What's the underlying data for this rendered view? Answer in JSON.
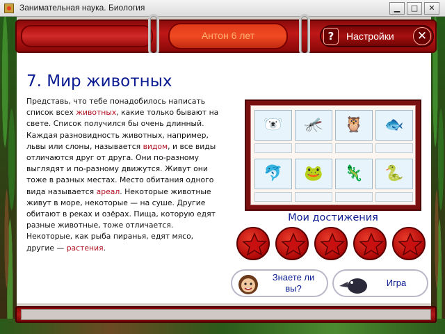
{
  "window": {
    "title": "Занимательная наука. Биология",
    "min_glyph": "▁",
    "max_glyph": "□",
    "close_glyph": "✕"
  },
  "header": {
    "user_label": "Антон 6 лет",
    "help_glyph": "?",
    "settings_label": "Настройки",
    "close_glyph": "✕"
  },
  "lesson": {
    "title": "7. Мир животных",
    "text_parts": [
      {
        "text": "Представь, что тебе понадобилось написать список всех ",
        "hl": false
      },
      {
        "text": "животных",
        "hl": true
      },
      {
        "text": ", какие только бывают на свете. Список получился бы очень длинный. Каждая разновидность животных, например, львы или слоны, называется ",
        "hl": false
      },
      {
        "text": "видом",
        "hl": true
      },
      {
        "text": ", и все виды отличаются друг от друга. Они по-разному выглядят и по-разному движутся. Живут они тоже в разных местах. Место обитания одного вида называется ",
        "hl": false
      },
      {
        "text": "ареал",
        "hl": true
      },
      {
        "text": ". Некоторые животные живут в море, некоторые — на суше. Другие обитают в реках и озёрах. Пища, которую едят разные животные, тоже отличается. Некоторые, как рыба пиранья, едят мясо, другие — ",
        "hl": false
      },
      {
        "text": "растения",
        "hl": true
      },
      {
        "text": ".",
        "hl": false
      }
    ]
  },
  "achievements": {
    "title": "Мои достижения",
    "cells": [
      {
        "icon": "polar-bear-icon",
        "glyph": "🐻‍❄️"
      },
      {
        "icon": "dragonfly-icon",
        "glyph": "🦟"
      },
      {
        "icon": "owl-icon",
        "glyph": "🦉"
      },
      {
        "icon": "piranha-icon",
        "glyph": "🐟"
      },
      {
        "icon": "dolphin-icon",
        "glyph": "🐬"
      },
      {
        "icon": "frog-icon",
        "glyph": "🐸"
      },
      {
        "icon": "chameleon-icon",
        "glyph": "🦎"
      },
      {
        "icon": "snake-icon",
        "glyph": "🐍"
      }
    ],
    "star_count": 5
  },
  "buttons": {
    "did_you_know": "Знаете ли вы?",
    "game": "Игра"
  },
  "colors": {
    "title_blue": "#0a1a90",
    "highlight_red": "#b01020",
    "header_red": "#c01818"
  }
}
